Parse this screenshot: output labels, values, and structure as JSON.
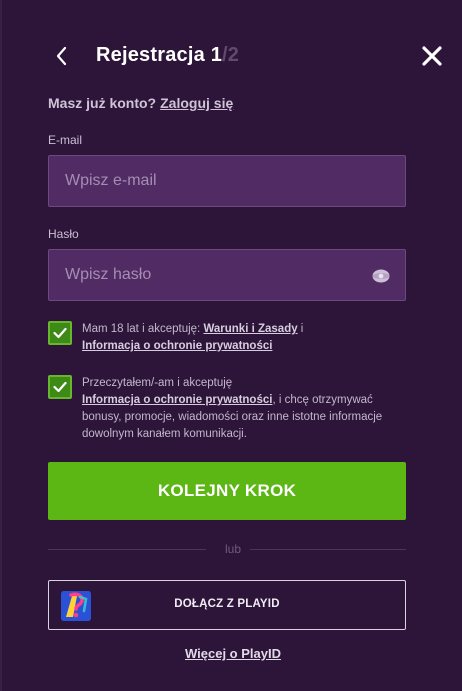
{
  "header": {
    "title": "Rejestracja 1",
    "step_total": "/2",
    "back_icon": "chevron-left-icon",
    "close_icon": "close-icon"
  },
  "login": {
    "prompt": "Masz już konto?",
    "link": "Zaloguj się"
  },
  "email": {
    "label": "E-mail",
    "placeholder": "Wpisz e-mail",
    "value": ""
  },
  "password": {
    "label": "Hasło",
    "placeholder": "Wpisz hasło",
    "value": "",
    "toggle_icon": "eye-icon"
  },
  "consents": [
    {
      "checked": true,
      "text_before": "Mam 18 lat i akceptuję: ",
      "link1": "Warunki i Zasady",
      "text_mid": " i",
      "link2": "Informacja o ochronie prywatności",
      "text_after": ""
    },
    {
      "checked": true,
      "text_before": "Przeczytałem/-am i akceptuję",
      "link1": "Informacja o ochronie prywatności",
      "text_after": ", i chcę otrzymywać bonusy, promocje, wiadomości oraz inne istotne informacje dowolnym kanałem komunikacji."
    }
  ],
  "next_button": "KOLEJNY KROK",
  "divider": "lub",
  "playid": {
    "button_label": "DOŁĄCZ Z PLAYID",
    "more_link": "Więcej o PlayID",
    "logo_icon": "playid-logo-icon"
  },
  "colors": {
    "background": "#2d1539",
    "field_bg": "#512b63",
    "accent_green": "#5cb614"
  }
}
